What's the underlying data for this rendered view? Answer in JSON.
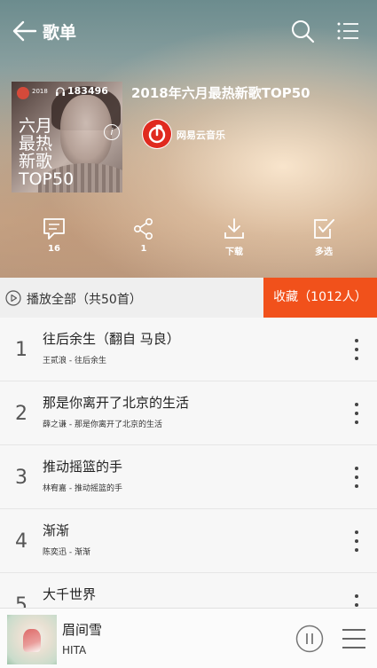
{
  "header": {
    "title": "歌单"
  },
  "cover": {
    "brand": "2018",
    "text_lines": [
      "六月",
      "最热",
      "新歌",
      "TOP50"
    ],
    "play_count": "183496"
  },
  "playlist": {
    "title": "2018年六月最热新歌TOP50",
    "creator": "网易云音乐"
  },
  "actions": [
    {
      "icon": "comment-icon",
      "label": "16"
    },
    {
      "icon": "share-icon",
      "label": "1"
    },
    {
      "icon": "download-icon",
      "label": "下载"
    },
    {
      "icon": "multi-select-icon",
      "label": "多选"
    }
  ],
  "play_all": {
    "label": "播放全部（共50首）"
  },
  "collect": {
    "label": "收藏（1012人）"
  },
  "songs": [
    {
      "index": "1",
      "name": "往后余生（翻自 马良）",
      "sub": "王贰浪 - 往后余生"
    },
    {
      "index": "2",
      "name": "那是你离开了北京的生活",
      "sub": "薛之谦 - 那是你离开了北京的生活"
    },
    {
      "index": "3",
      "name": "推动摇篮的手",
      "sub": "林宥嘉 - 推动摇篮的手"
    },
    {
      "index": "4",
      "name": "渐渐",
      "sub": "陈奕迅 - 渐渐"
    },
    {
      "index": "5",
      "name": "大千世界",
      "sub": ""
    }
  ],
  "player": {
    "title": "眉间雪",
    "artist": "HITA"
  },
  "colors": {
    "accent": "#f1511b",
    "netease_red": "#e02a1f"
  }
}
